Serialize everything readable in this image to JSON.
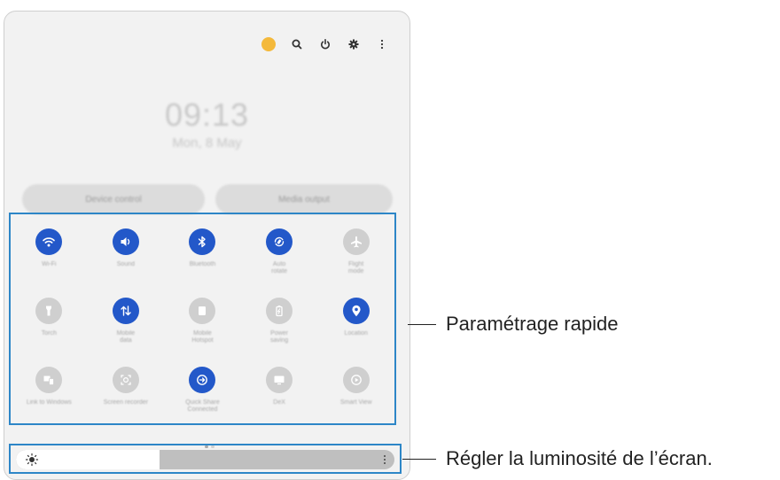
{
  "status": {
    "time": "09:13",
    "date": "Mon, 8 May"
  },
  "top_icons": [
    "profile-icon",
    "search-icon",
    "power-icon",
    "settings-icon",
    "more-icon"
  ],
  "buttons": {
    "left": "Device control",
    "right": "Media output"
  },
  "tiles": [
    {
      "label": "Wi-Fi",
      "icon": "wifi-icon",
      "on": true
    },
    {
      "label": "Sound",
      "icon": "sound-icon",
      "on": true
    },
    {
      "label": "Bluetooth",
      "icon": "bluetooth-icon",
      "on": true
    },
    {
      "label": "Auto\nrotate",
      "icon": "auto-rotate-icon",
      "on": true
    },
    {
      "label": "Flight\nmode",
      "icon": "airplane-icon",
      "on": false
    },
    {
      "label": "Torch",
      "icon": "torch-icon",
      "on": false
    },
    {
      "label": "Mobile\ndata",
      "icon": "mobile-data-icon",
      "on": true
    },
    {
      "label": "Mobile\nHotspot",
      "icon": "hotspot-icon",
      "on": false
    },
    {
      "label": "Power\nsaving",
      "icon": "power-saving-icon",
      "on": false
    },
    {
      "label": "Location",
      "icon": "location-icon",
      "on": true
    },
    {
      "label": "Link to Windows",
      "icon": "link-windows-icon",
      "on": false
    },
    {
      "label": "Screen recorder",
      "icon": "screen-recorder-icon",
      "on": false
    },
    {
      "label": "Quick Share\nConnected",
      "icon": "quick-share-icon",
      "on": true
    },
    {
      "label": "DeX",
      "icon": "dex-icon",
      "on": false
    },
    {
      "label": "Smart View",
      "icon": "smart-view-icon",
      "on": false
    }
  ],
  "brightness": {
    "level": 0.38
  },
  "callouts": {
    "quick_settings": "Paramétrage rapide",
    "brightness": "Régler la luminosité de l’écran."
  },
  "colors": {
    "accent": "#2358c9",
    "frame": "#2d86c7"
  }
}
